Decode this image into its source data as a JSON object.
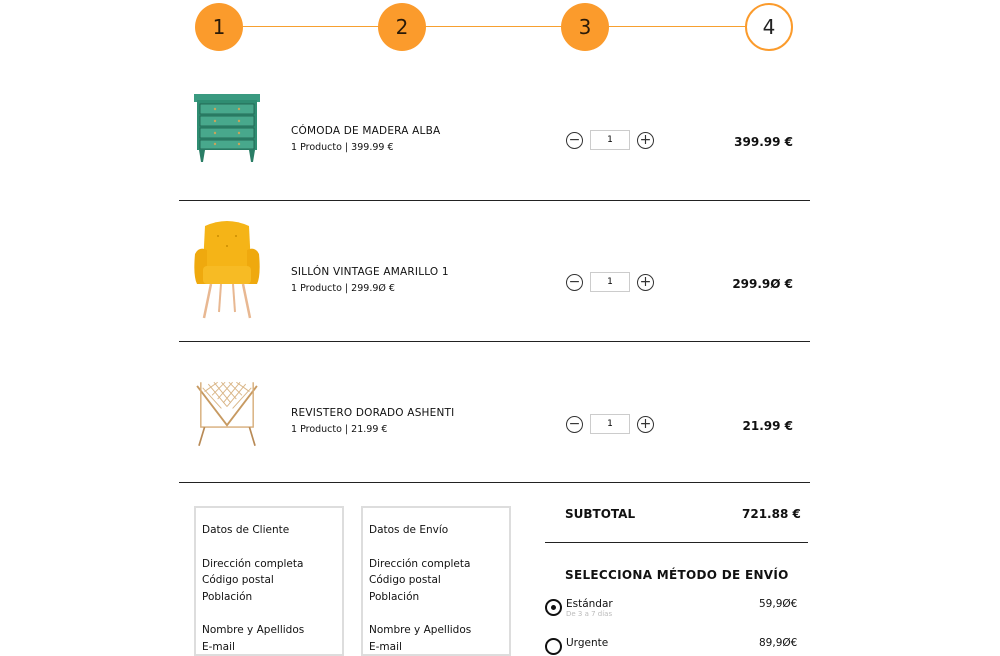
{
  "stepper": {
    "steps": [
      {
        "label": "1",
        "state": "done"
      },
      {
        "label": "2",
        "state": "done"
      },
      {
        "label": "3",
        "state": "done"
      },
      {
        "label": "4",
        "state": "current"
      }
    ],
    "accent_color": "#fb9b2c"
  },
  "cart": {
    "items": [
      {
        "name": "Cómoda de madera Alba",
        "meta": "1 Producto | 399.99 €",
        "quantity": "1",
        "price": "399.99 €",
        "image_icon": "green-dresser-image"
      },
      {
        "name": "Sillón vintage amarillo 1",
        "meta": "1 Producto | 299.9Ø €",
        "quantity": "1",
        "price": "299.9Ø €",
        "image_icon": "yellow-armchair-image"
      },
      {
        "name": "Revistero dorado Ashenti",
        "meta": "1 Producto | 21.99 €",
        "quantity": "1",
        "price": "21.99 €",
        "image_icon": "gold-magazine-rack-image"
      }
    ]
  },
  "client_box": {
    "title": "Datos de Cliente",
    "lines_address": [
      "Dirección completa",
      "Código postal",
      "Población"
    ],
    "lines_contact": [
      "Nombre y Apellidos",
      "E-mail"
    ]
  },
  "shipping_box": {
    "title": "Datos de Envío",
    "lines_address": [
      "Dirección completa",
      "Código postal",
      "Población"
    ],
    "lines_contact": [
      "Nombre y Apellidos",
      "E-mail"
    ]
  },
  "summary": {
    "subtotal_label": "SUBTOTAL",
    "subtotal_value": "721.88 €",
    "shipping_title": "Selecciona método de envío",
    "options": [
      {
        "name": "Estándar",
        "sub": "De 3 a 7 días",
        "price": "59,9Ø€",
        "selected": true
      },
      {
        "name": "Urgente",
        "sub": "",
        "price": "89,9Ø€",
        "selected": false
      }
    ]
  }
}
